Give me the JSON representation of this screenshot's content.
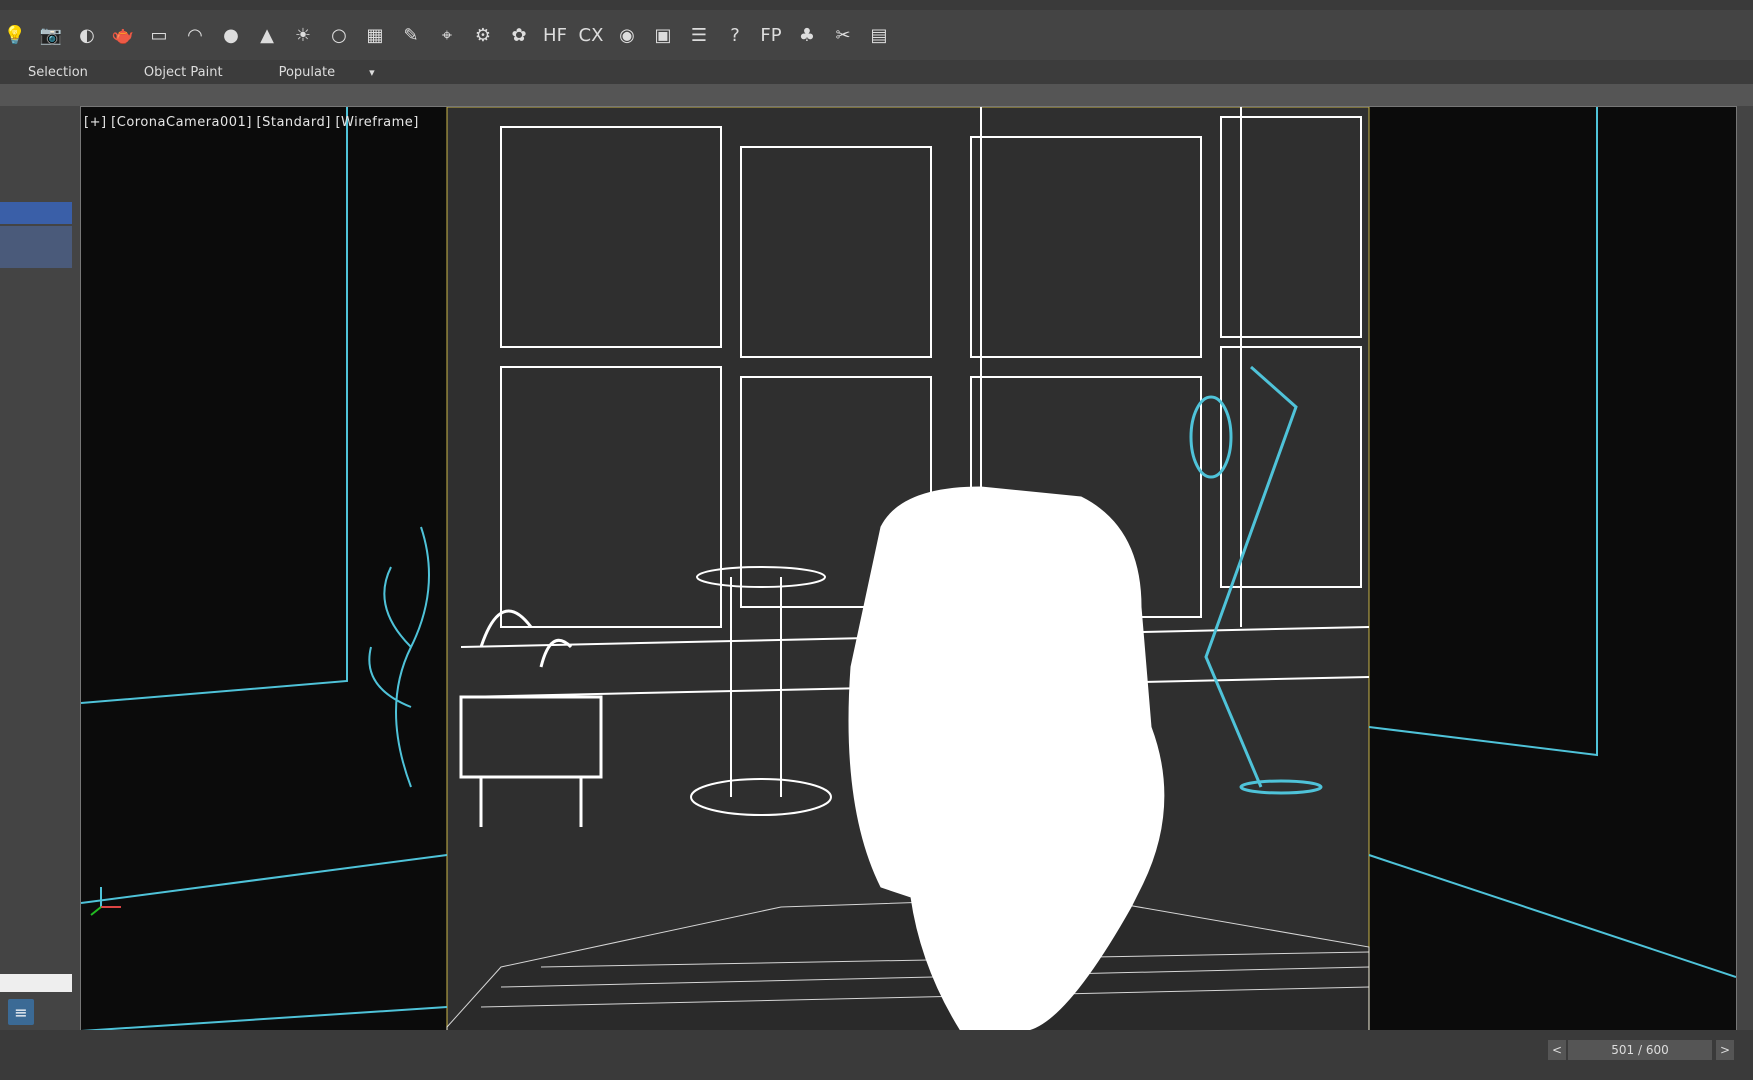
{
  "tabs": [
    "Selection",
    "Object Paint",
    "Populate"
  ],
  "tab_menu_arrow": "▾",
  "viewport_label": "[+] [CoronaCamera001] [Standard] [Wireframe]",
  "frame_counter": "501 / 600",
  "nav_prev": "<",
  "nav_next": ">",
  "toolbar_icons": [
    "light-bulb-icon",
    "camera-icon",
    "half-sphere-icon",
    "teapot-icon",
    "plane-icon",
    "dome-icon",
    "sphere-icon",
    "cone-icon",
    "sun-icon",
    "circle-icon",
    "grid-icon",
    "wand-icon",
    "target-icon",
    "gear-icon",
    "plant-icon",
    "hf-icon",
    "cx-icon",
    "material-icon",
    "render-icon",
    "teapot-render-icon",
    "help-icon",
    "fp-icon",
    "tree-icon",
    "tools-icon",
    "table-icon"
  ],
  "toolbar_glyphs": [
    "💡",
    "📷",
    "◐",
    "🫖",
    "▭",
    "◠",
    "●",
    "▲",
    "☀",
    "○",
    "▦",
    "✎",
    "⌖",
    "⚙",
    "✿",
    "HF",
    "CX",
    "◉",
    "▣",
    "☰",
    "?",
    "FP",
    "♣",
    "✂",
    "▤"
  ],
  "colors": {
    "accent": "#4fc3d9",
    "wire_white": "#ffffff",
    "viewport_border": "#c8b44a",
    "selection_blue": "#3a5fa8"
  }
}
